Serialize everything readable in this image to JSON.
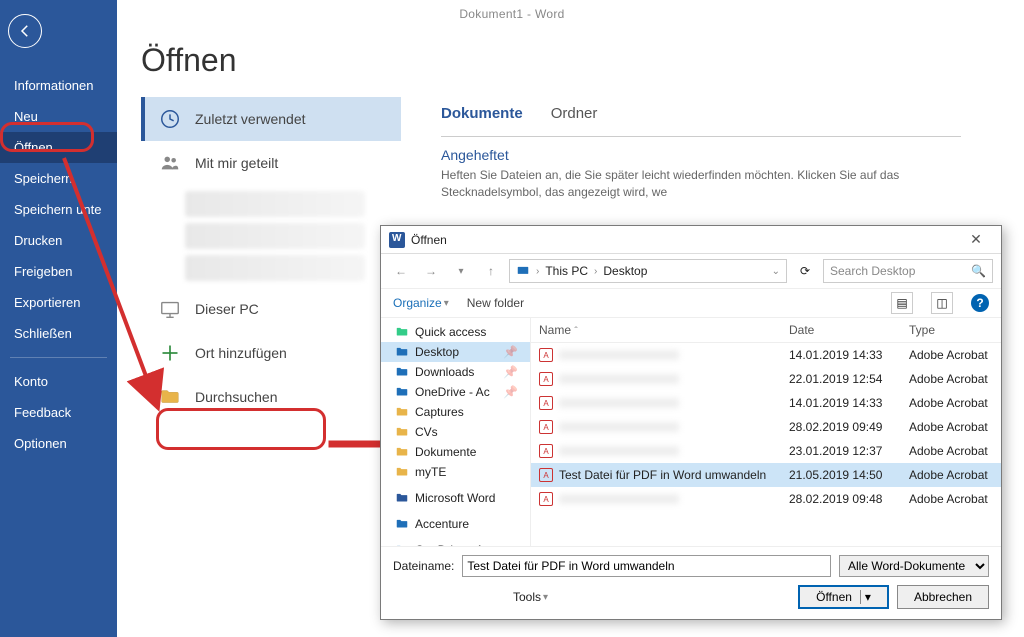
{
  "titlebar": "Dokument1  -  Word",
  "backstage": {
    "items": [
      "Informationen",
      "Neu",
      "Öffnen",
      "Speichern",
      "Speichern unte",
      "Drucken",
      "Freigeben",
      "Exportieren",
      "Schließen"
    ],
    "bottom": [
      "Konto",
      "Feedback",
      "Optionen"
    ],
    "selected_index": 2
  },
  "page": {
    "title": "Öffnen",
    "sources": {
      "recent": "Zuletzt verwendet",
      "shared": "Mit mir geteilt",
      "thispc": "Dieser PC",
      "addplace": "Ort hinzufügen",
      "browse": "Durchsuchen"
    },
    "tabs": {
      "docs": "Dokumente",
      "folders": "Ordner"
    },
    "pinned_heading": "Angeheftet",
    "pinned_text": "Heften Sie Dateien an, die Sie später leicht wiederfinden möchten. Klicken Sie auf das Stecknadelsymbol, das angezeigt wird, we"
  },
  "dialog": {
    "title": "Öffnen",
    "path": [
      "This PC",
      "Desktop"
    ],
    "search_placeholder": "Search Desktop",
    "organize": "Organize",
    "new_folder": "New folder",
    "tree": [
      "Quick access",
      "Desktop",
      "Downloads",
      "OneDrive - Ac",
      "Captures",
      "CVs",
      "Dokumente",
      "myTE",
      "",
      "Microsoft Word",
      "",
      "Accenture",
      "",
      "OneDrive - Accent"
    ],
    "tree_sel_index": 1,
    "columns": {
      "name": "Name",
      "date": "Date",
      "type": "Type"
    },
    "files": [
      {
        "name": "",
        "date": "14.01.2019 14:33",
        "type": "Adobe Acrobat",
        "blur": true
      },
      {
        "name": "",
        "date": "22.01.2019 12:54",
        "type": "Adobe Acrobat",
        "blur": true
      },
      {
        "name": "",
        "date": "14.01.2019 14:33",
        "type": "Adobe Acrobat",
        "blur": true
      },
      {
        "name": "",
        "date": "28.02.2019 09:49",
        "type": "Adobe Acrobat",
        "blur": true
      },
      {
        "name": "",
        "date": "23.01.2019 12:37",
        "type": "Adobe Acrobat",
        "blur": true
      },
      {
        "name": "Test Datei für PDF in Word umwandeln",
        "date": "21.05.2019 14:50",
        "type": "Adobe Acrobat",
        "blur": false,
        "selected": true
      },
      {
        "name": "",
        "date": "28.02.2019 09:48",
        "type": "Adobe Acrobat",
        "blur": true
      }
    ],
    "filename_label": "Dateiname:",
    "filename_value": "Test Datei für PDF in Word umwandeln",
    "filter": "Alle Word-Dokumente",
    "tools": "Tools",
    "open_btn": "Öffnen",
    "cancel_btn": "Abbrechen"
  }
}
